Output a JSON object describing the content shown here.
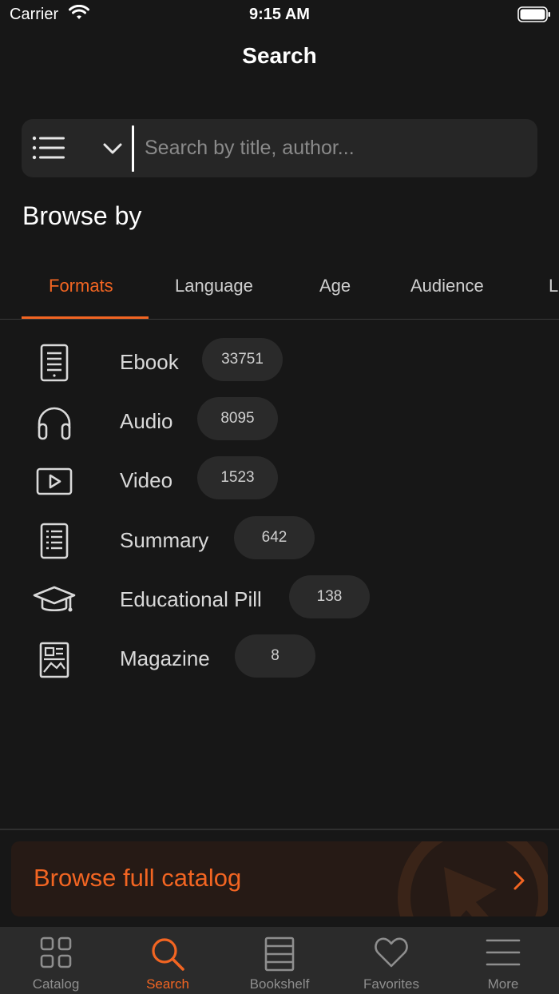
{
  "status_bar": {
    "carrier": "Carrier",
    "time": "9:15 AM"
  },
  "nav": {
    "title": "Search"
  },
  "search": {
    "placeholder": "Search by title, author...",
    "value": ""
  },
  "browse": {
    "heading": "Browse by",
    "tabs": [
      {
        "label": "Formats",
        "active": true
      },
      {
        "label": "Language"
      },
      {
        "label": "Age"
      },
      {
        "label": "Audience"
      },
      {
        "label": "L"
      }
    ],
    "formats": [
      {
        "label": "Ebook",
        "count": "33751",
        "icon": "ebook-icon"
      },
      {
        "label": "Audio",
        "count": "8095",
        "icon": "headphones-icon"
      },
      {
        "label": "Video",
        "count": "1523",
        "icon": "video-play-icon"
      },
      {
        "label": "Summary",
        "count": "642",
        "icon": "summary-document-icon"
      },
      {
        "label": "Educational Pill",
        "count": "138",
        "icon": "graduation-cap-icon"
      },
      {
        "label": "Magazine",
        "count": "8",
        "icon": "magazine-icon"
      }
    ]
  },
  "catalog_banner": {
    "label": "Browse full catalog"
  },
  "tab_bar": {
    "items": [
      {
        "label": "Catalog",
        "icon": "grid-icon"
      },
      {
        "label": "Search",
        "icon": "search-icon",
        "active": true
      },
      {
        "label": "Bookshelf",
        "icon": "bookshelf-icon"
      },
      {
        "label": "Favorites",
        "icon": "heart-icon"
      },
      {
        "label": "More",
        "icon": "menu-icon"
      }
    ]
  },
  "colors": {
    "accent": "#f26522",
    "background": "#171717",
    "surface": "#262626"
  }
}
